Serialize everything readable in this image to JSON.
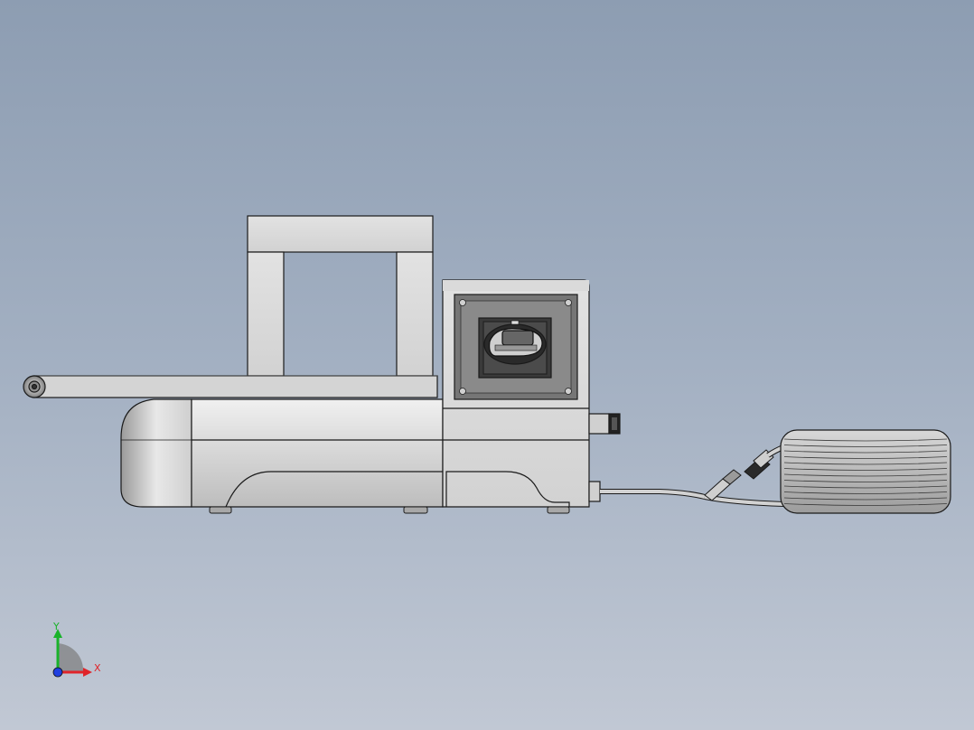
{
  "triad": {
    "x_label": "X",
    "y_label": "Y",
    "x_color": "#e0242a",
    "y_color": "#19b22a",
    "z_color": "#1f3fe0"
  },
  "colors": {
    "background_top": "#8d9db2",
    "background_bottom": "#c1c8d4",
    "body_fill": "#dcdcdc",
    "edge": "#1a1a1a",
    "panel_dark": "#777777"
  },
  "icons": {
    "switch": "rotary-switch-icon",
    "cable": "cable-coil-icon",
    "triad": "axis-triad-icon"
  }
}
